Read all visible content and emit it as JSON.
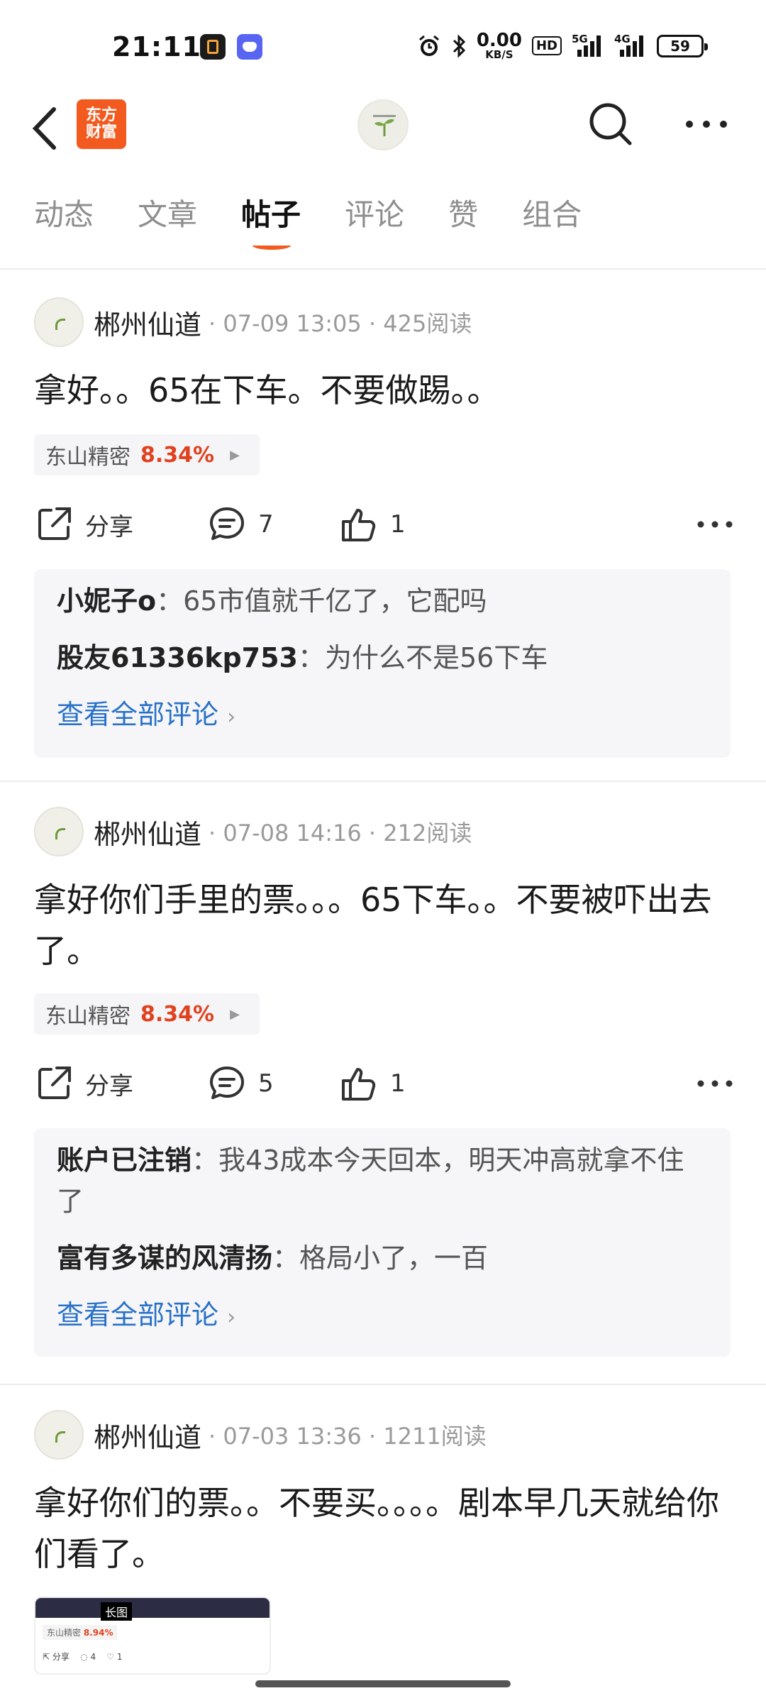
{
  "status_bar": {
    "time": "21:11",
    "net_speed": "0.00",
    "net_unit": "KB/S",
    "hd": "HD",
    "sig1": "5G",
    "sig2": "4G",
    "battery": "59"
  },
  "header": {
    "logo_line1": "东方",
    "logo_line2": "财富"
  },
  "tabs": [
    {
      "label": "动态"
    },
    {
      "label": "文章"
    },
    {
      "label": "帖子"
    },
    {
      "label": "评论"
    },
    {
      "label": "赞"
    },
    {
      "label": "组合"
    }
  ],
  "posts": [
    {
      "author": "郴州仙道",
      "meta": "· 07-09 13:05 · 425阅读",
      "text": "拿好。。65在下车。不要做踢。。",
      "stock": {
        "name": "东山精密",
        "change": "8.34%"
      },
      "share_label": "分享",
      "comment_count": "7",
      "like_count": "1",
      "comments": [
        {
          "name": "小妮子o",
          "text": "：65市值就千亿了，它配吗"
        },
        {
          "name": "股友61336kp753",
          "text": "：为什么不是56下车"
        }
      ],
      "view_all": "查看全部评论"
    },
    {
      "author": "郴州仙道",
      "meta": "· 07-08 14:16 · 212阅读",
      "text": "拿好你们手里的票。。。65下车。。不要被吓出去了。",
      "stock": {
        "name": "东山精密",
        "change": "8.34%"
      },
      "share_label": "分享",
      "comment_count": "5",
      "like_count": "1",
      "comments": [
        {
          "name": "账户已注销",
          "text": "：我43成本今天回本，明天冲高就拿不住了"
        },
        {
          "name": "富有多谋的风清扬",
          "text": "：格局小了，一百"
        }
      ],
      "view_all": "查看全部评论"
    },
    {
      "author": "郴州仙道",
      "meta": "· 07-03 13:36 · 1211阅读",
      "text": "拿好你们的票。。不要买。。。。剧本早几天就给你们看了。",
      "thumb": {
        "badge": "长图",
        "stock": "东山精密",
        "change": "8.94%",
        "share": "分享",
        "comments": "4",
        "likes": "1"
      }
    }
  ],
  "colors": {
    "accent": "#f35a1f",
    "up": "#e0421f",
    "link": "#2871c8"
  }
}
